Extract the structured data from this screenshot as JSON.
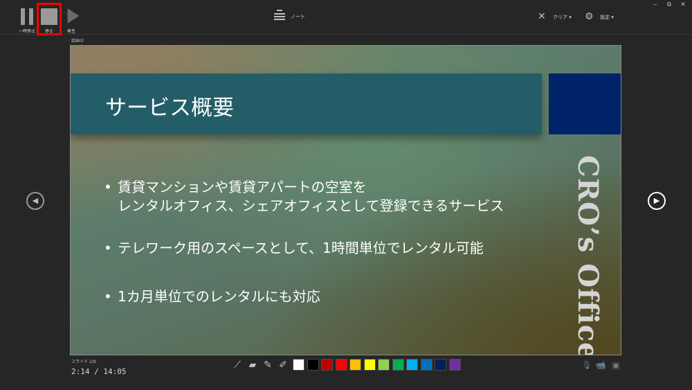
{
  "window_controls": {
    "minimize": "‒",
    "restore": "⧉",
    "close": "✕"
  },
  "toolbar": {
    "pause_label": "一時停止",
    "stop_label": "停止",
    "play_label": "再生",
    "notes_label": "ノート",
    "clear_label": "クリア ▾",
    "settings_label": "設定 ▾"
  },
  "status": {
    "top_label": "録画中"
  },
  "slide": {
    "title": "サービス概要",
    "brand": "CRO’s Office",
    "bullets": [
      {
        "marker": "•",
        "lines": [
          "賃貸マンションや賃貸アパートの空室を",
          "レンタルオフィス、シェアオフィスとして登録できるサービス"
        ]
      },
      {
        "marker": "•",
        "lines": [
          "テレワーク用のスペースとして、1時間単位でレンタル可能"
        ]
      },
      {
        "marker": "•",
        "lines": [
          "1カ月単位でのレンタルにも対応"
        ]
      }
    ],
    "colors": {
      "title_band": "#235e68",
      "navy_block": "#002369"
    }
  },
  "navigation": {
    "prev_glyph": "◀",
    "next_glyph": "▶"
  },
  "footer": {
    "slide_number": "スライド 2/8",
    "timer": "2:14 / 14:05"
  },
  "pen_colors": [
    "#ffffff",
    "#000000",
    "#c00000",
    "#ff0000",
    "#ffc000",
    "#ffff00",
    "#92d050",
    "#00b050",
    "#00b0f0",
    "#0070c0",
    "#002060",
    "#7030a0"
  ],
  "accent_colors": {
    "stop_highlight": "#ff0000"
  }
}
